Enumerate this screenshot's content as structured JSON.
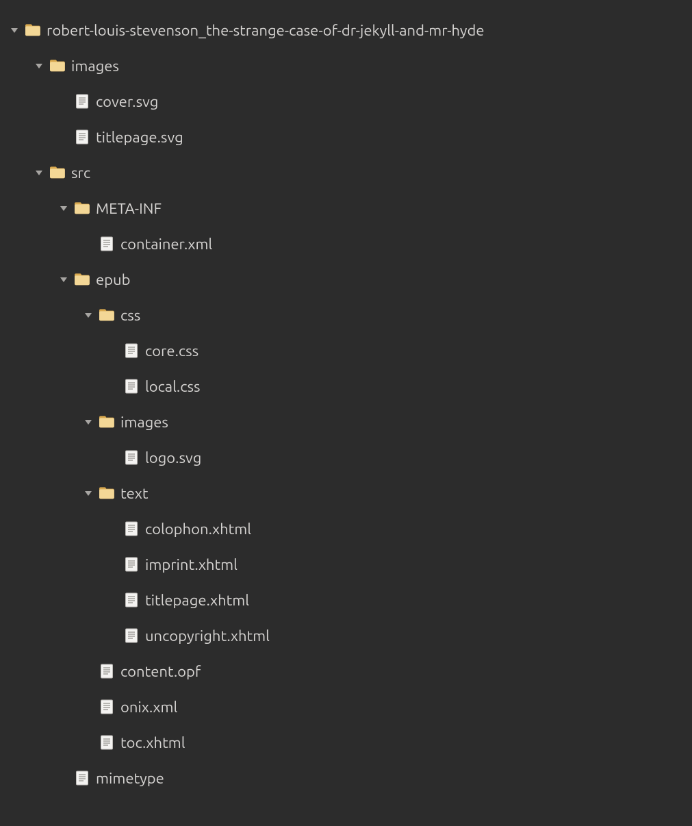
{
  "colors": {
    "bg": "#2c2c2c",
    "text": "#d6d4d2",
    "arrow": "#a7a5a2",
    "folderLight": "#f3d796",
    "folderDark": "#d9a94f",
    "fileFill": "#f4f3f1",
    "fileStroke": "#bcbab6",
    "fileLines": "#9c9a96"
  },
  "tree": {
    "name": "robert-louis-stevenson_the-strange-case-of-dr-jekyll-and-mr-hyde",
    "type": "folder",
    "expanded": true,
    "children": [
      {
        "name": "images",
        "type": "folder",
        "expanded": true,
        "children": [
          {
            "name": "cover.svg",
            "type": "file"
          },
          {
            "name": "titlepage.svg",
            "type": "file"
          }
        ]
      },
      {
        "name": "src",
        "type": "folder",
        "expanded": true,
        "children": [
          {
            "name": "META-INF",
            "type": "folder",
            "expanded": true,
            "children": [
              {
                "name": "container.xml",
                "type": "file"
              }
            ]
          },
          {
            "name": "epub",
            "type": "folder",
            "expanded": true,
            "children": [
              {
                "name": "css",
                "type": "folder",
                "expanded": true,
                "children": [
                  {
                    "name": "core.css",
                    "type": "file"
                  },
                  {
                    "name": "local.css",
                    "type": "file"
                  }
                ]
              },
              {
                "name": "images",
                "type": "folder",
                "expanded": true,
                "children": [
                  {
                    "name": "logo.svg",
                    "type": "file"
                  }
                ]
              },
              {
                "name": "text",
                "type": "folder",
                "expanded": true,
                "children": [
                  {
                    "name": "colophon.xhtml",
                    "type": "file"
                  },
                  {
                    "name": "imprint.xhtml",
                    "type": "file"
                  },
                  {
                    "name": "titlepage.xhtml",
                    "type": "file"
                  },
                  {
                    "name": "uncopyright.xhtml",
                    "type": "file"
                  }
                ]
              },
              {
                "name": "content.opf",
                "type": "file"
              },
              {
                "name": "onix.xml",
                "type": "file"
              },
              {
                "name": "toc.xhtml",
                "type": "file"
              }
            ]
          },
          {
            "name": "mimetype",
            "type": "file"
          }
        ]
      }
    ]
  }
}
